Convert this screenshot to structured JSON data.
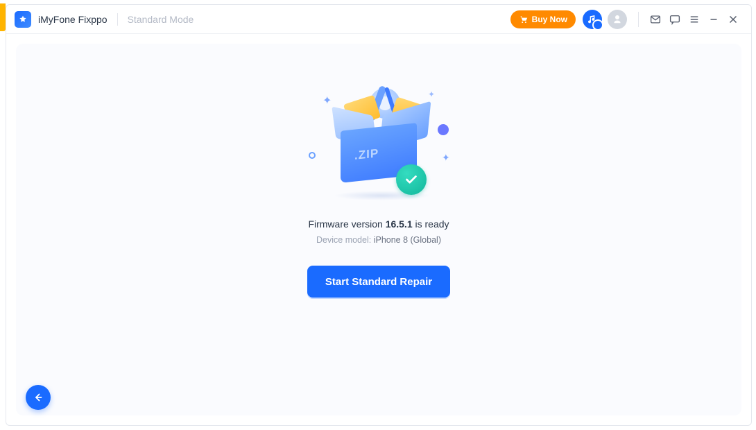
{
  "header": {
    "app_title": "iMyFone Fixppo",
    "mode_label": "Standard Mode",
    "buy_now_label": "Buy Now"
  },
  "main": {
    "firmware_prefix": "Firmware version ",
    "firmware_version": "16.5.1",
    "firmware_suffix": " is ready",
    "device_label": "Device model: ",
    "device_model": "iPhone 8 (Global)",
    "illustration_zip_label": ".ZIP",
    "cta_label": "Start Standard Repair"
  },
  "colors": {
    "accent": "#1a6bff",
    "buy_now": "#ff8a00",
    "success": "#11b79a"
  }
}
